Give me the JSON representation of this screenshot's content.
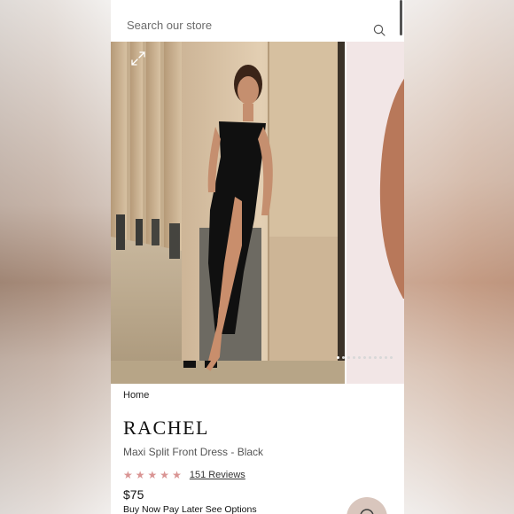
{
  "search": {
    "placeholder": "Search our store"
  },
  "breadcrumb": {
    "home_label": "Home"
  },
  "product": {
    "name": "RACHEL",
    "subtitle": "Maxi Split Front Dress - Black",
    "rating_stars": 5,
    "reviews_label": "151 Reviews",
    "price": "$75",
    "pay_later": "Buy Now Pay Later See Options"
  },
  "gallery": {
    "image_count": 11,
    "active_index": 0
  },
  "colors": {
    "star": "#d99493",
    "text_primary": "#111111",
    "text_secondary": "#555555",
    "background": "#ffffff"
  },
  "icons": {
    "search": "search-icon",
    "expand": "expand-icon",
    "star": "star-icon",
    "chat": "chat-icon"
  }
}
